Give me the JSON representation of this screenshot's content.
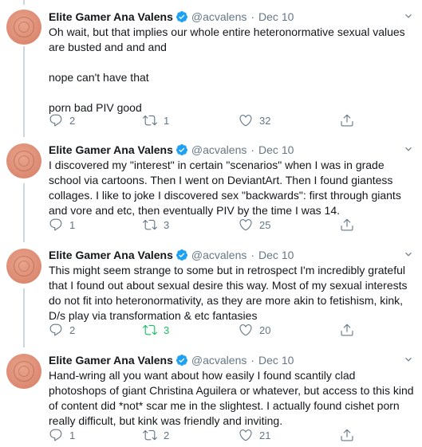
{
  "icons": {
    "reply": "reply-icon",
    "retweet": "retweet-icon",
    "like": "heart-icon",
    "share": "share-icon",
    "verified": "verified-badge-icon",
    "caret": "chevron-down-icon"
  },
  "colors": {
    "text": "#14171a",
    "muted": "#657786",
    "verified": "#1da1f2",
    "retweet_active": "#17bf63",
    "thread_line": "#ccd6dd",
    "divider": "#e6ecf0"
  },
  "tweets": [
    {
      "author": {
        "name": "Elite Gamer Ana Valens",
        "handle": "@acvalens",
        "verified": true
      },
      "separator": "·",
      "date": "Dec 10",
      "paragraphs": [
        "Oh wait, but that implies our whole entire heteronormative sexual values are busted and and and",
        "nope can't have that",
        "porn bad PIV good"
      ],
      "replies": "2",
      "retweets": "1",
      "retweeted": false,
      "likes": "32"
    },
    {
      "author": {
        "name": "Elite Gamer Ana Valens",
        "handle": "@acvalens",
        "verified": true
      },
      "separator": "·",
      "date": "Dec 10",
      "paragraphs": [
        "I discovered my \"interest\" in certain \"scenarios\" when I was in grade school via cartoons. Then I went on DeviantArt. Then I found giantess collages. I like to joke I discovered sex \"backwards\": first through giants and vore and etc, then eventually PIV by the time I was 14."
      ],
      "replies": "1",
      "retweets": "3",
      "retweeted": false,
      "likes": "25"
    },
    {
      "author": {
        "name": "Elite Gamer Ana Valens",
        "handle": "@acvalens",
        "verified": true
      },
      "separator": "·",
      "date": "Dec 10",
      "paragraphs": [
        "This might seem strange to some but in retrospect I'm incredibly grateful that I found out about sexual desire this way. Most of my sexual interests do not fit into heteronormativity, as they are more akin to fetishism, kink, D/s play via transformation & etc fantasies"
      ],
      "replies": "2",
      "retweets": "3",
      "retweeted": true,
      "likes": "20"
    },
    {
      "author": {
        "name": "Elite Gamer Ana Valens",
        "handle": "@acvalens",
        "verified": true
      },
      "separator": "·",
      "date": "Dec 10",
      "paragraphs": [
        "Hand-wring all you want about how easily I found scantily clad photoshops of giant Christina Aguilera or whatever, but access to this kind of content did *not* scar me in the slightest. I actually found cishet porn really difficult, but kink was friendly and inviting."
      ],
      "replies": "1",
      "retweets": "2",
      "retweeted": false,
      "likes": "21"
    }
  ]
}
